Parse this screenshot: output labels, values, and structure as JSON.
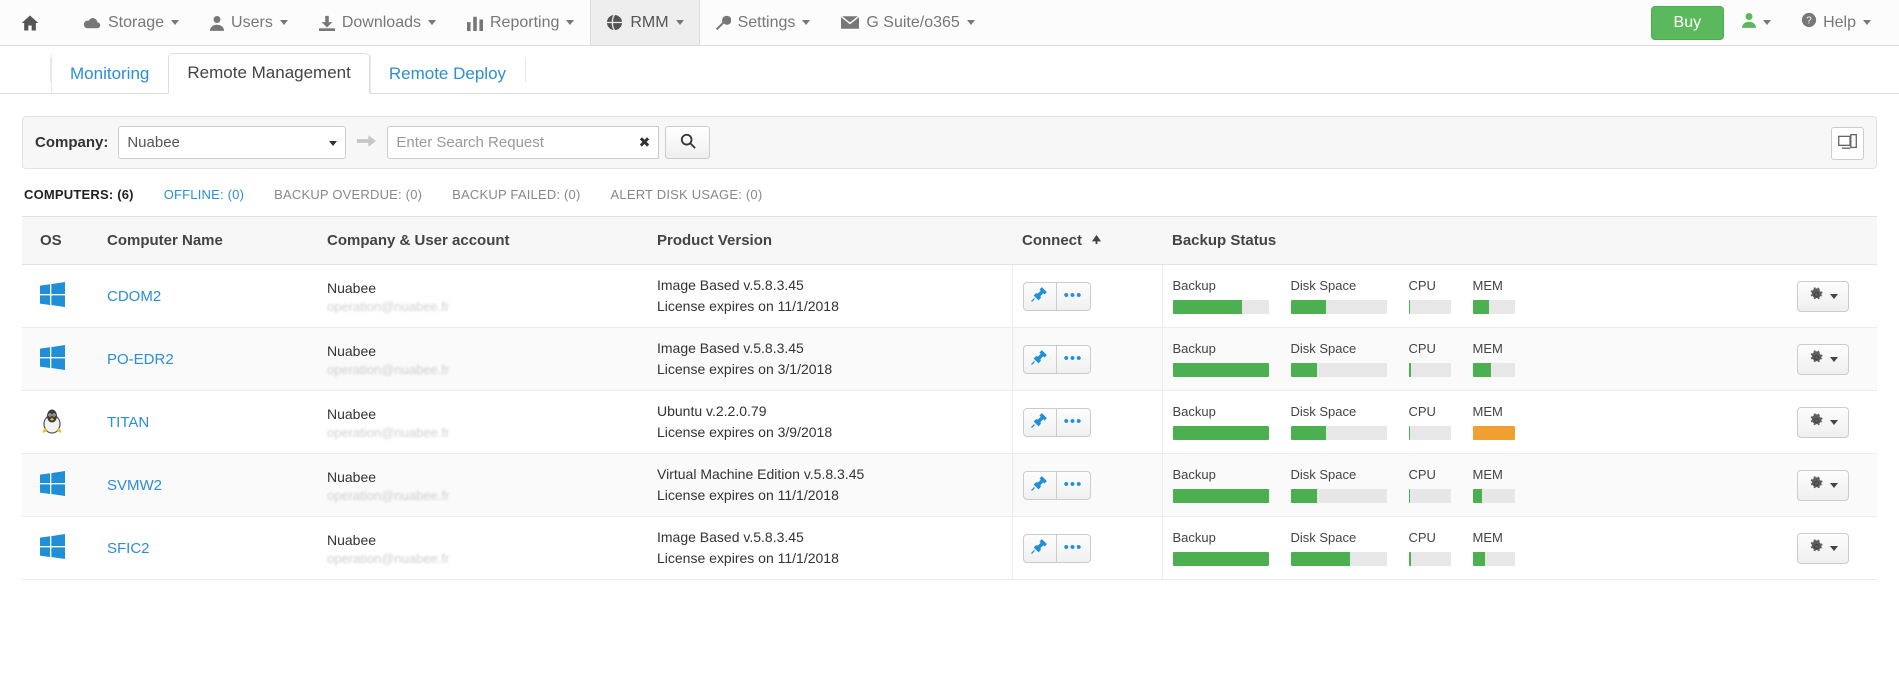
{
  "navbar": {
    "home_icon": "home-icon",
    "items": [
      {
        "label": "Storage",
        "icon": "cloud-icon",
        "caret": true,
        "active": false
      },
      {
        "label": "Users",
        "icon": "user-icon",
        "caret": true,
        "active": false
      },
      {
        "label": "Downloads",
        "icon": "download-icon",
        "caret": true,
        "active": false
      },
      {
        "label": "Reporting",
        "icon": "bar-chart-icon",
        "caret": true,
        "active": false
      },
      {
        "label": "RMM",
        "icon": "globe-icon",
        "caret": true,
        "active": true
      },
      {
        "label": "Settings",
        "icon": "wrench-icon",
        "caret": true,
        "active": false
      },
      {
        "label": "G Suite/o365",
        "icon": "envelope-icon",
        "caret": true,
        "active": false
      }
    ],
    "buy_label": "Buy",
    "user_icon": "user-icon",
    "help_label": "Help",
    "help_icon": "question-circle-icon"
  },
  "tabs": [
    {
      "label": "Monitoring",
      "active": false
    },
    {
      "label": "Remote Management",
      "active": true
    },
    {
      "label": "Remote Deploy",
      "active": false
    }
  ],
  "search": {
    "company_label": "Company:",
    "company_value": "Nuabee",
    "arrow_icon": "arrow-right-icon",
    "placeholder": "Enter Search Request",
    "input_value": "",
    "clear_icon": "clear-x-icon",
    "search_icon": "search-icon",
    "grid_toggle_icon": "display-toggle-icon"
  },
  "status_filters": [
    {
      "label": "COMPUTERS: (6)",
      "style": "strong"
    },
    {
      "label": "OFFLINE: (0)",
      "style": "link"
    },
    {
      "label": "BACKUP OVERDUE: (0)",
      "style": "muted"
    },
    {
      "label": "BACKUP FAILED: (0)",
      "style": "muted"
    },
    {
      "label": "ALERT DISK USAGE: (0)",
      "style": "muted"
    }
  ],
  "table": {
    "headers": {
      "os": "OS",
      "name": "Computer Name",
      "company": "Company & User account",
      "product": "Product Version",
      "connect": "Connect",
      "connect_sort_icon": "sort-asc-icon",
      "backup": "Backup Status"
    },
    "metric_labels": {
      "backup": "Backup",
      "disk": "Disk Space",
      "cpu": "CPU",
      "mem": "MEM"
    },
    "connect_icons": {
      "plug": "plug-icon",
      "more": "ellipsis-icon"
    },
    "gear_icon": "gear-icon",
    "rows": [
      {
        "os": "windows",
        "name": "CDOM2",
        "company": "Nuabee",
        "user": "operation@nuabee.fr",
        "product": "Image Based v.5.8.3.45",
        "license": "License expires on 11/1/2018",
        "metrics": {
          "backup": {
            "pct": 72,
            "color": "#4caf50"
          },
          "disk": {
            "pct": 37,
            "color": "#4caf50"
          },
          "cpu": {
            "pct": 4,
            "color": "#4caf50"
          },
          "mem": {
            "pct": 40,
            "color": "#4caf50"
          }
        }
      },
      {
        "os": "windows",
        "name": "PO-EDR2",
        "company": "Nuabee",
        "user": "operation@nuabee.fr",
        "product": "Image Based v.5.8.3.45",
        "license": "License expires on 3/1/2018",
        "metrics": {
          "backup": {
            "pct": 100,
            "color": "#4caf50"
          },
          "disk": {
            "pct": 28,
            "color": "#4caf50"
          },
          "cpu": {
            "pct": 6,
            "color": "#4caf50"
          },
          "mem": {
            "pct": 45,
            "color": "#4caf50"
          }
        }
      },
      {
        "os": "linux",
        "name": "TITAN",
        "company": "Nuabee",
        "user": "operation@nuabee.fr",
        "product": "Ubuntu v.2.2.0.79",
        "license": "License expires on 3/9/2018",
        "metrics": {
          "backup": {
            "pct": 100,
            "color": "#4caf50"
          },
          "disk": {
            "pct": 37,
            "color": "#4caf50"
          },
          "cpu": {
            "pct": 4,
            "color": "#4caf50"
          },
          "mem": {
            "pct": 100,
            "color": "#f0a030"
          }
        }
      },
      {
        "os": "windows",
        "name": "SVMW2",
        "company": "Nuabee",
        "user": "operation@nuabee.fr",
        "product": "Virtual Machine Edition v.5.8.3.45",
        "license": "License expires on 11/1/2018",
        "metrics": {
          "backup": {
            "pct": 100,
            "color": "#4caf50"
          },
          "disk": {
            "pct": 28,
            "color": "#4caf50"
          },
          "cpu": {
            "pct": 4,
            "color": "#4caf50"
          },
          "mem": {
            "pct": 22,
            "color": "#4caf50"
          }
        }
      },
      {
        "os": "windows",
        "name": "SFIC2",
        "company": "Nuabee",
        "user": "operation@nuabee.fr",
        "product": "Image Based v.5.8.3.45",
        "license": "License expires on 11/1/2018",
        "metrics": {
          "backup": {
            "pct": 100,
            "color": "#4caf50"
          },
          "disk": {
            "pct": 62,
            "color": "#4caf50"
          },
          "cpu": {
            "pct": 5,
            "color": "#4caf50"
          },
          "mem": {
            "pct": 30,
            "color": "#4caf50"
          }
        }
      }
    ]
  }
}
